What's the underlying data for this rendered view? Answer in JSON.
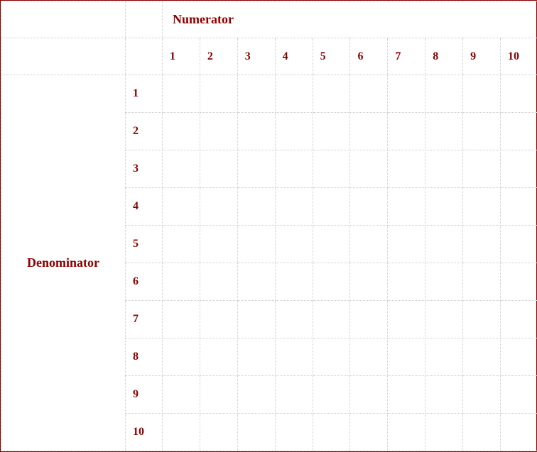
{
  "headers": {
    "numerator": "Numerator",
    "denominator": "Denominator"
  },
  "numerators": [
    "1",
    "2",
    "3",
    "4",
    "5",
    "6",
    "7",
    "8",
    "9",
    "10"
  ],
  "denominators": [
    "1",
    "2",
    "3",
    "4",
    "5",
    "6",
    "7",
    "8",
    "9",
    "10"
  ],
  "cells": [
    [
      "",
      "",
      "",
      "",
      "",
      "",
      "",
      "",
      "",
      ""
    ],
    [
      "",
      "",
      "",
      "",
      "",
      "",
      "",
      "",
      "",
      ""
    ],
    [
      "",
      "",
      "",
      "",
      "",
      "",
      "",
      "",
      "",
      ""
    ],
    [
      "",
      "",
      "",
      "",
      "",
      "",
      "",
      "",
      "",
      ""
    ],
    [
      "",
      "",
      "",
      "",
      "",
      "",
      "",
      "",
      "",
      ""
    ],
    [
      "",
      "",
      "",
      "",
      "",
      "",
      "",
      "",
      "",
      ""
    ],
    [
      "",
      "",
      "",
      "",
      "",
      "",
      "",
      "",
      "",
      ""
    ],
    [
      "",
      "",
      "",
      "",
      "",
      "",
      "",
      "",
      "",
      ""
    ],
    [
      "",
      "",
      "",
      "",
      "",
      "",
      "",
      "",
      "",
      ""
    ],
    [
      "",
      "",
      "",
      "",
      "",
      "",
      "",
      "",
      "",
      ""
    ]
  ]
}
